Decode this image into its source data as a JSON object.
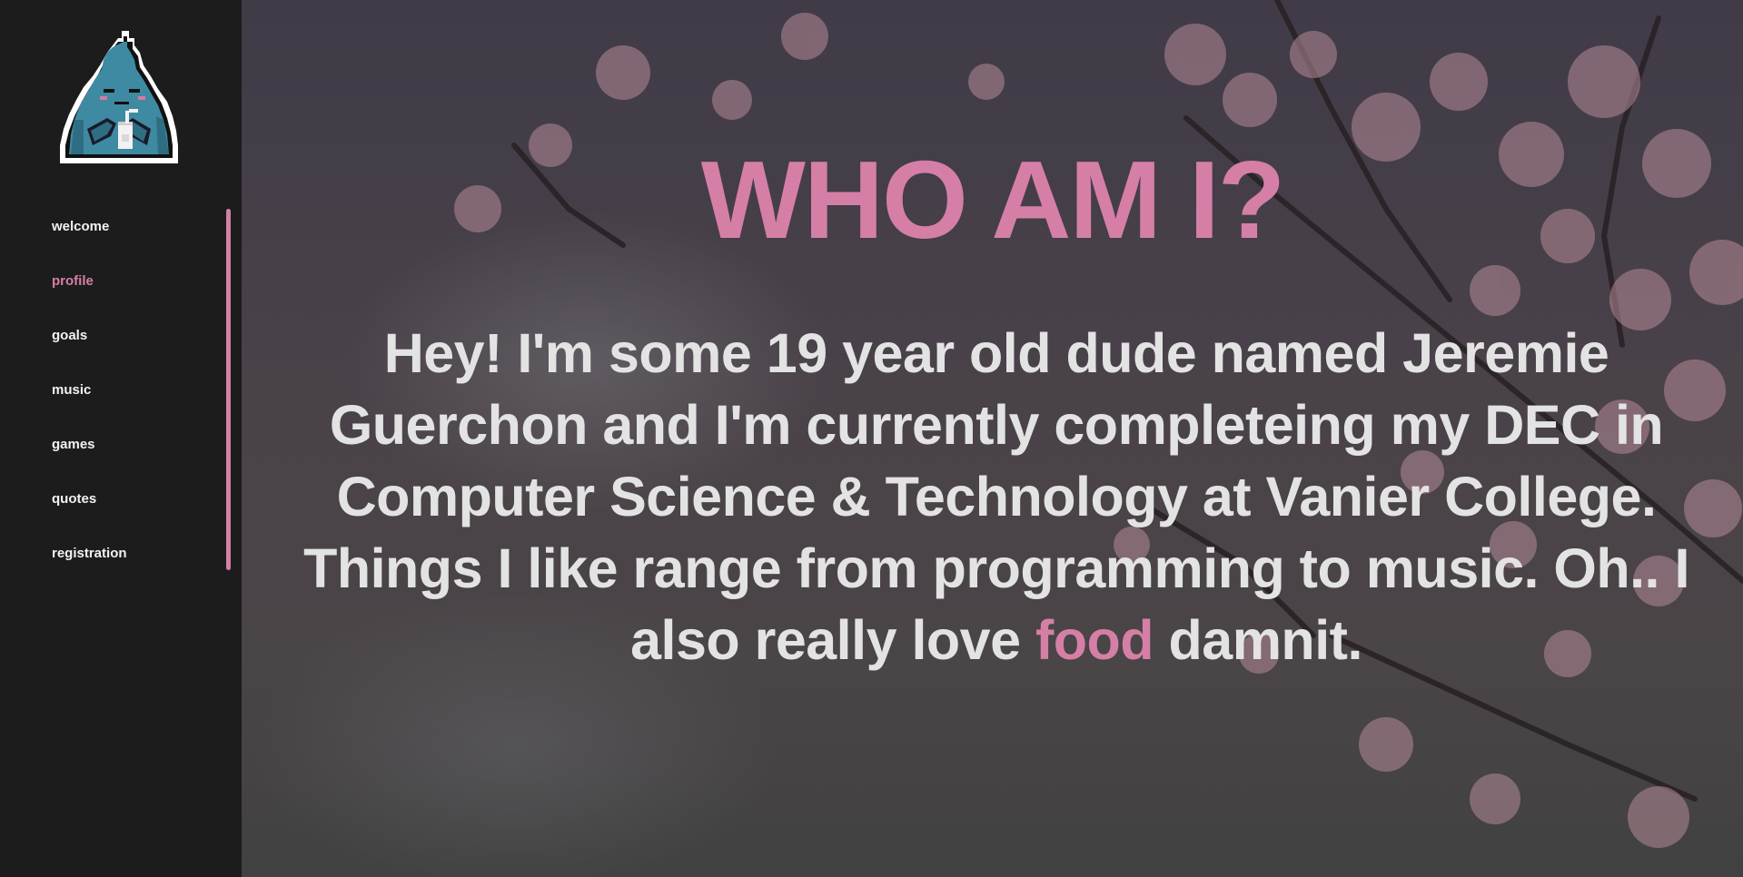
{
  "sidebar": {
    "logo_icon": "pixel-mascot-icon",
    "nav": [
      {
        "label": "welcome",
        "active": false
      },
      {
        "label": "profile",
        "active": true
      },
      {
        "label": "goals",
        "active": false
      },
      {
        "label": "music",
        "active": false
      },
      {
        "label": "games",
        "active": false
      },
      {
        "label": "quotes",
        "active": false
      },
      {
        "label": "registration",
        "active": false
      }
    ]
  },
  "main": {
    "title": "WHO AM I?",
    "bio_before": "Hey! I'm some 19 year old dude named Jeremie Guerchon and I'm currently completeing my DEC in Computer Science & Technology at Vanier College. Things I like range from programming to music. Oh.. I also really love ",
    "bio_highlight": "food",
    "bio_after": " damnit."
  },
  "colors": {
    "accent": "#d57fa7",
    "sidebar_bg": "#1c1c1c",
    "text": "#e3e3e3"
  }
}
